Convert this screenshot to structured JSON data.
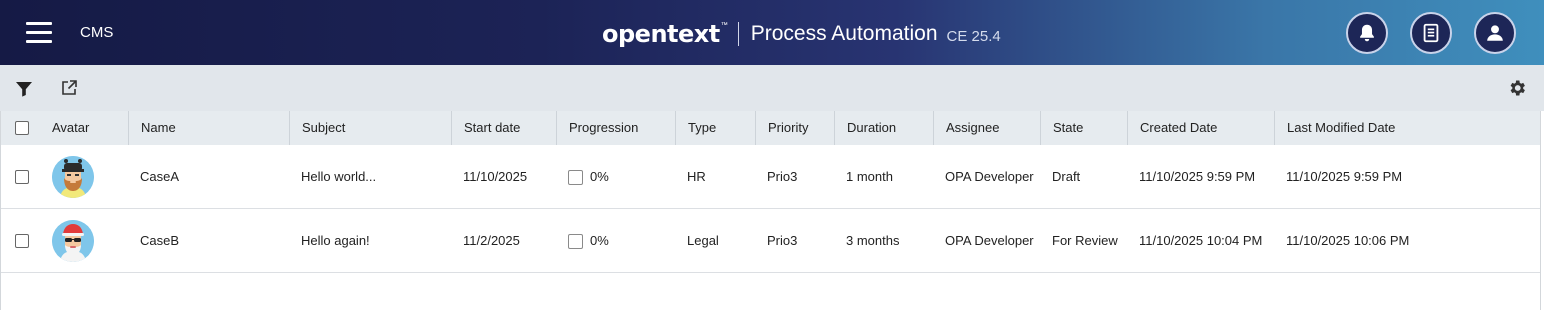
{
  "header": {
    "app_label": "CMS",
    "brand_logo": "opentext",
    "brand_tm": "™",
    "brand_product": "Process Automation",
    "brand_version": "CE 25.4",
    "icons": [
      "menu-icon",
      "bell-icon",
      "document-icon",
      "user-icon"
    ]
  },
  "toolbar": {
    "icons": [
      "filter-icon",
      "export-icon",
      "settings-gear-icon"
    ]
  },
  "table": {
    "columns": [
      "Avatar",
      "Name",
      "Subject",
      "Start date",
      "Progression",
      "Type",
      "Priority",
      "Duration",
      "Assignee",
      "State",
      "Created Date",
      "Last Modified Date"
    ],
    "rows": [
      {
        "avatar": "avatar-bearded-man-cap",
        "name": "CaseA",
        "subject": "Hello world...",
        "start_date": "11/10/2025",
        "progression": "0%",
        "type": "HR",
        "priority": "Prio3",
        "duration": "1 month",
        "assignee": "OPA Developer",
        "state": "Draft",
        "created": "11/10/2025 9:59 PM",
        "modified": "11/10/2025 9:59 PM"
      },
      {
        "avatar": "avatar-santa-hat-sunglasses",
        "name": "CaseB",
        "subject": "Hello again!",
        "start_date": "11/2/2025",
        "progression": "0%",
        "type": "Legal",
        "priority": "Prio3",
        "duration": "3 months",
        "assignee": "OPA Developer",
        "state": "For Review",
        "created": "11/10/2025 10:04 PM",
        "modified": "11/10/2025 10:06 PM"
      }
    ]
  },
  "colors": {
    "header_dark": "#151a45",
    "header_light": "#3f8fbd",
    "toolbar_bg": "#e1e6eb",
    "table_header_bg": "#e6ebef"
  }
}
